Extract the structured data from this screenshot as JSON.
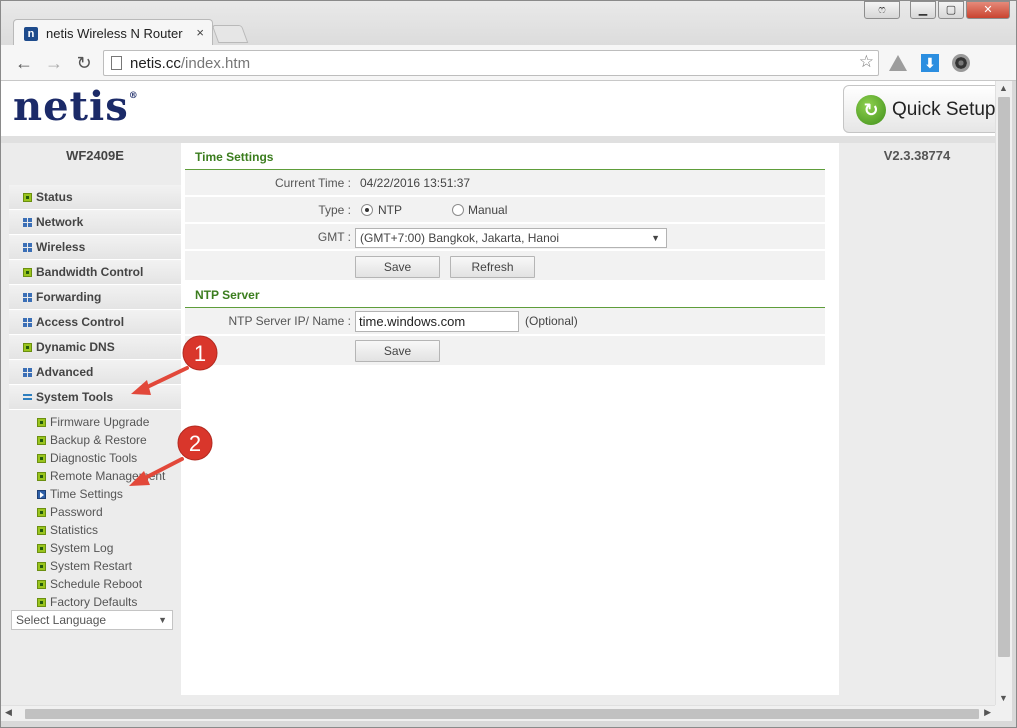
{
  "browser": {
    "tab_title": "netis Wireless N Router",
    "tab_favicon": "n",
    "tab_close": "×",
    "url_host": "netis.cc",
    "url_path": "/index.htm",
    "window_buttons": {
      "badge": "ෆ",
      "minimize": "▁",
      "maximize": "▢",
      "close": "✕"
    },
    "nav": {
      "back": "←",
      "forward": "→",
      "reload": "↻"
    },
    "star": "☆",
    "menu": "≡",
    "download_glyph": "⬇",
    "scroll": {
      "up": "▲",
      "down": "▼",
      "left": "◀",
      "right": "▶"
    }
  },
  "header": {
    "logo": "netis",
    "logo_mark": "®",
    "quick_setup_label": "Quick Setup",
    "quick_setup_icon": "↻"
  },
  "sidebar": {
    "model": "WF2409E",
    "items": [
      {
        "label": "Status",
        "icon": "green-square-icon"
      },
      {
        "label": "Network",
        "icon": "blue-grid-icon"
      },
      {
        "label": "Wireless",
        "icon": "blue-grid-icon"
      },
      {
        "label": "Bandwidth Control",
        "icon": "green-square-icon"
      },
      {
        "label": "Forwarding",
        "icon": "blue-grid-icon"
      },
      {
        "label": "Access Control",
        "icon": "blue-grid-icon"
      },
      {
        "label": "Dynamic DNS",
        "icon": "green-square-icon"
      },
      {
        "label": "Advanced",
        "icon": "blue-grid-icon"
      },
      {
        "label": "System Tools",
        "icon": "blue-bars-icon"
      }
    ],
    "subitems": [
      {
        "label": "Firmware Upgrade",
        "active": false
      },
      {
        "label": "Backup & Restore",
        "active": false
      },
      {
        "label": "Diagnostic Tools",
        "active": false
      },
      {
        "label": "Remote Management",
        "active": false
      },
      {
        "label": "Time Settings",
        "active": true
      },
      {
        "label": "Password",
        "active": false
      },
      {
        "label": "Statistics",
        "active": false
      },
      {
        "label": "System Log",
        "active": false
      },
      {
        "label": "System Restart",
        "active": false
      },
      {
        "label": "Schedule Reboot",
        "active": false
      },
      {
        "label": "Factory Defaults",
        "active": false
      }
    ],
    "language_select": "Select Language",
    "select_arrow": "▼"
  },
  "version": "V2.3.38774",
  "time_settings": {
    "title": "Time Settings",
    "current_time_label": "Current Time :",
    "current_time_value": "04/22/2016 13:51:37",
    "type_label": "Type :",
    "type_options": [
      "NTP",
      "Manual"
    ],
    "type_selected": "NTP",
    "gmt_label": "GMT :",
    "gmt_value": "(GMT+7:00) Bangkok, Jakarta, Hanoi",
    "save_label": "Save",
    "refresh_label": "Refresh"
  },
  "ntp_server": {
    "title": "NTP Server",
    "label": "NTP Server IP/ Name :",
    "value": "time.windows.com",
    "optional_hint": "(Optional)",
    "save_label": "Save"
  },
  "annotations": [
    {
      "number": "1"
    },
    {
      "number": "2"
    }
  ],
  "colors": {
    "logo": "#1b2a68",
    "section_title": "#3b7d1e",
    "bullet_green": "#9ac51e",
    "bullet_blue": "#3b6fb6",
    "annotation_red": "#d9362b"
  }
}
